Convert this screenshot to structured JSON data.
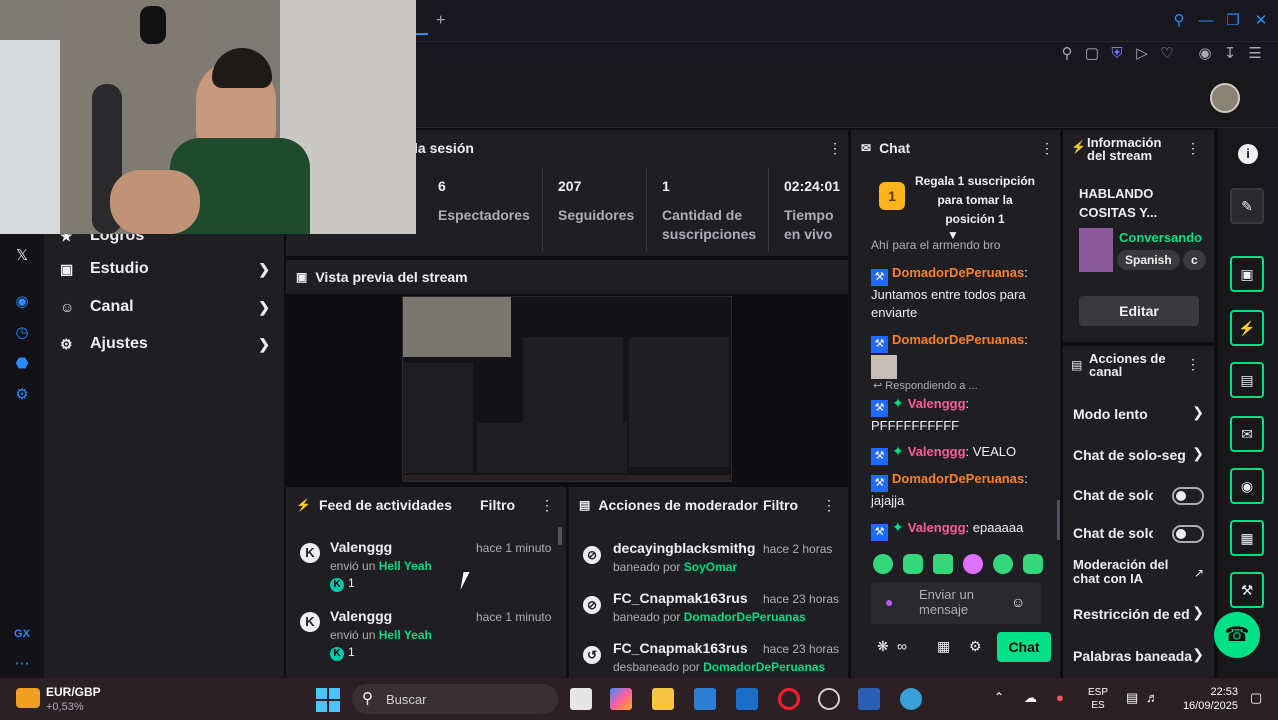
{
  "browser": {
    "tab_plus": "+",
    "window_controls": [
      "search-icon",
      "minimize-icon",
      "restore-icon",
      "close-icon"
    ]
  },
  "left_nav": {
    "items": [
      {
        "label": "Logros",
        "icon": "trophy-icon"
      },
      {
        "label": "Estudio",
        "icon": "camera-icon"
      },
      {
        "label": "Canal",
        "icon": "users-icon"
      },
      {
        "label": "Ajustes",
        "icon": "gear-icon"
      }
    ]
  },
  "gx_sidebar": {
    "label": "GX"
  },
  "session": {
    "title_partial": "la sesión",
    "stats": [
      {
        "value": "6",
        "label": "Espectadores"
      },
      {
        "value": "207",
        "label": "Seguidores"
      },
      {
        "value": "1",
        "label": "Cantidad de suscripciones"
      },
      {
        "value": "02:24:01",
        "label": "Tiempo en vivo"
      }
    ]
  },
  "preview": {
    "title": "Vista previa del stream"
  },
  "feed": {
    "title": "Feed de actividades",
    "filter_label": "Filtro",
    "items": [
      {
        "user": "Valenggg",
        "time": "hace 1 minuto",
        "action": "envió un",
        "reward": "Hell Yeah",
        "count": "1"
      },
      {
        "user": "Valenggg",
        "time": "hace 1 minuto",
        "action": "envió un",
        "reward": "Hell Yeah",
        "count": "1"
      }
    ]
  },
  "moderator": {
    "title": "Acciones de moderador",
    "filter_label": "Filtro",
    "items": [
      {
        "user": "decayingblacksmithg",
        "time": "hace 2 horas",
        "action": "baneado por",
        "by": "SoyOmar",
        "icon": "ban-icon"
      },
      {
        "user": "FC_Cnapmak163rus",
        "time": "hace 23 horas",
        "action": "baneado por",
        "by": "DomadorDePeruanas",
        "icon": "ban-icon"
      },
      {
        "user": "FC_Cnapmak163rus",
        "time": "hace 23 horas",
        "action": "desbaneado por",
        "by": "DomadorDePeruanas",
        "icon": "undo-icon"
      }
    ]
  },
  "chat": {
    "title": "Chat",
    "gift_number": "1",
    "gift_text": "Regala 1 suscripción para tomar la posición 1",
    "partial_line": "Ahí para el armendo bro",
    "replying_to": "Respondiendo a ...",
    "messages": [
      {
        "user": "DomadorDePeruanas",
        "text": "Juntamos entre todos para enviarte",
        "color": "orange",
        "gem": false
      },
      {
        "user": "DomadorDePeruanas",
        "text": "",
        "color": "orange",
        "gem": false
      },
      {
        "user": "Valenggg",
        "text": "PFFFFFFFFFF",
        "color": "pink",
        "gem": true
      },
      {
        "user": "Valenggg",
        "text": "VEALO",
        "color": "pink",
        "gem": true
      },
      {
        "user": "DomadorDePeruanas",
        "text": "jajajja",
        "color": "orange",
        "gem": false
      },
      {
        "user": "Valenggg",
        "text": "epaaaaa",
        "color": "pink",
        "gem": true
      }
    ],
    "input_placeholder": "Enviar un mensaje",
    "send_label": "Chat"
  },
  "stream_info": {
    "title": "Información del stream",
    "stream_title": "HABLANDO COSITAS Y...",
    "category": "Conversando",
    "tags": [
      "Spanish",
      "c"
    ],
    "edit_label": "Editar"
  },
  "channel_actions": {
    "title": "Acciones de canal",
    "items": [
      {
        "label": "Modo lento",
        "control": "chevron"
      },
      {
        "label": "Chat de solo-seg",
        "control": "chevron"
      },
      {
        "label": "Chat de solo...",
        "control": "toggle",
        "enabled": false
      },
      {
        "label": "Chat de solo...",
        "control": "toggle",
        "enabled": false
      },
      {
        "label": "Moderación del chat con IA",
        "control": "external"
      },
      {
        "label": "Restricción de ed",
        "control": "chevron"
      },
      {
        "label": "Palabras baneada",
        "control": "chevron"
      }
    ]
  },
  "taskbar": {
    "stock_pair": "EUR/GBP",
    "stock_change": "+0,53%",
    "search_placeholder": "Buscar",
    "lang_top": "ESP",
    "lang_bottom": "ES",
    "time": "22:53",
    "date": "16/09/2025"
  },
  "colors": {
    "accent_green": "#00e086",
    "twitch_purple": "#9147ff",
    "orange_user": "#ff7f27",
    "pink_user": "#ff5d98"
  }
}
